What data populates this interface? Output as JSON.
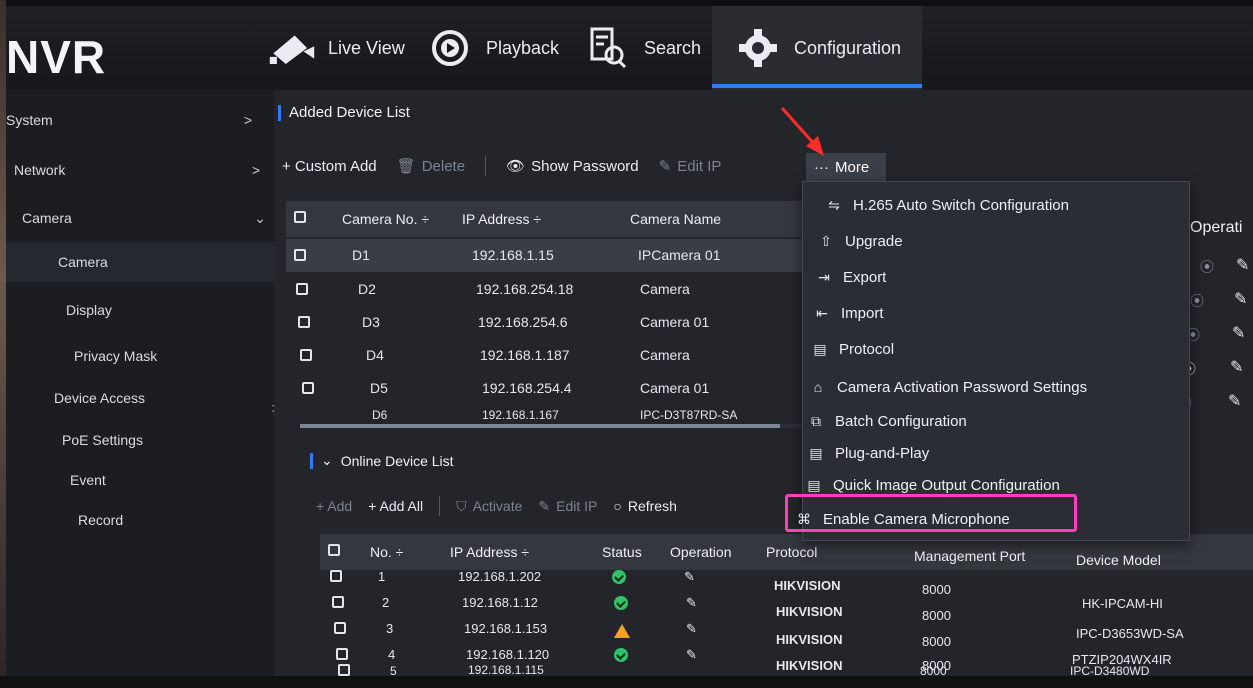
{
  "brand": "NVR",
  "nav": [
    {
      "label": "Live View",
      "icon": "camera-icon"
    },
    {
      "label": "Playback",
      "icon": "play-circle-icon"
    },
    {
      "label": "Search",
      "icon": "search-file-icon"
    },
    {
      "label": "Configuration",
      "icon": "gear-icon"
    }
  ],
  "sidebar": {
    "items": [
      {
        "label": "System",
        "arrow": ">"
      },
      {
        "label": "Network",
        "arrow": ">"
      },
      {
        "label": "Camera",
        "arrow": "⌄"
      },
      {
        "label": "Camera",
        "arrow": ""
      },
      {
        "label": "Display",
        "arrow": ""
      },
      {
        "label": "Privacy Mask",
        "arrow": ""
      },
      {
        "label": "Device Access",
        "arrow": ">"
      },
      {
        "label": "PoE Settings",
        "arrow": ">"
      },
      {
        "label": "Event",
        "arrow": ">"
      },
      {
        "label": "Record",
        "arrow": ">"
      }
    ]
  },
  "added": {
    "title": "Added Device List",
    "toolbar": {
      "custom_add": "+ Custom Add",
      "delete": "Delete",
      "show_password": "Show Password",
      "edit_ip": "Edit IP",
      "more": "More"
    },
    "headers": {
      "camera_no": "Camera No. ÷",
      "ip": "IP Address ÷",
      "name": "Camera Name",
      "operation": "Operati"
    },
    "rows": [
      {
        "no": "D1",
        "ip": "192.168.1.15",
        "name": "IPCamera 01"
      },
      {
        "no": "D2",
        "ip": "192.168.254.18",
        "name": "Camera"
      },
      {
        "no": "D3",
        "ip": "192.168.254.6",
        "name": "Camera 01"
      },
      {
        "no": "D4",
        "ip": "192.168.1.187",
        "name": "Camera"
      },
      {
        "no": "D5",
        "ip": "192.168.254.4",
        "name": "Camera 01"
      },
      {
        "no": "D6",
        "ip": "192.168.1.167",
        "name": "IPC-D3T87RD-SA"
      }
    ]
  },
  "more_menu": {
    "items": [
      {
        "label": "H.265 Auto Switch Configuration",
        "icon": "⇋"
      },
      {
        "label": "Upgrade",
        "icon": "⇧"
      },
      {
        "label": "Export",
        "icon": "⇥"
      },
      {
        "label": "Import",
        "icon": "⇤"
      },
      {
        "label": "Protocol",
        "icon": "▤"
      },
      {
        "label": "Camera Activation Password Settings",
        "icon": "⌂"
      },
      {
        "label": "Batch Configuration",
        "icon": "⧉"
      },
      {
        "label": "Plug-and-Play",
        "icon": "▤"
      },
      {
        "label": "Quick Image Output Configuration",
        "icon": "▤"
      },
      {
        "label": "Enable Camera Microphone",
        "icon": "⌘"
      }
    ]
  },
  "online": {
    "title": "Online Device List",
    "toolbar": {
      "add": "+ Add",
      "add_all": "+ Add All",
      "activate": "Activate",
      "edit_ip": "Edit IP",
      "refresh": "Refresh"
    },
    "headers": {
      "no": "No. ÷",
      "ip": "IP Address ÷",
      "status": "Status",
      "operation": "Operation",
      "protocol": "Protocol",
      "port": "Management Port",
      "model": "Device Model"
    },
    "rows": [
      {
        "no": "1",
        "ip": "192.168.1.202",
        "status": "ok",
        "protocol": "HIKVISION",
        "port": "8000",
        "model": "HK-IPCAM-HI"
      },
      {
        "no": "2",
        "ip": "192.168.1.12",
        "status": "ok",
        "protocol": "HIKVISION",
        "port": "8000",
        "model": "HK-IPCAM-HI"
      },
      {
        "no": "3",
        "ip": "192.168.1.153",
        "status": "warn",
        "protocol": "HIKVISION",
        "port": "8000",
        "model": "IPC-D3653WD-SA"
      },
      {
        "no": "4",
        "ip": "192.168.1.120",
        "status": "ok",
        "protocol": "HIKVISION",
        "port": "8000",
        "model": "PTZIP204WX4IR"
      },
      {
        "no": "5",
        "ip": "192.168.1.115",
        "status": "ok",
        "protocol": "",
        "port": "8000",
        "model": "IPC-D3480WD"
      }
    ]
  },
  "colors": {
    "accent": "#2f7cf6",
    "highlight": "#ff3fbf",
    "ok": "#2fc46a",
    "warn": "#f4a21c",
    "arrow": "#ff2a2a"
  }
}
